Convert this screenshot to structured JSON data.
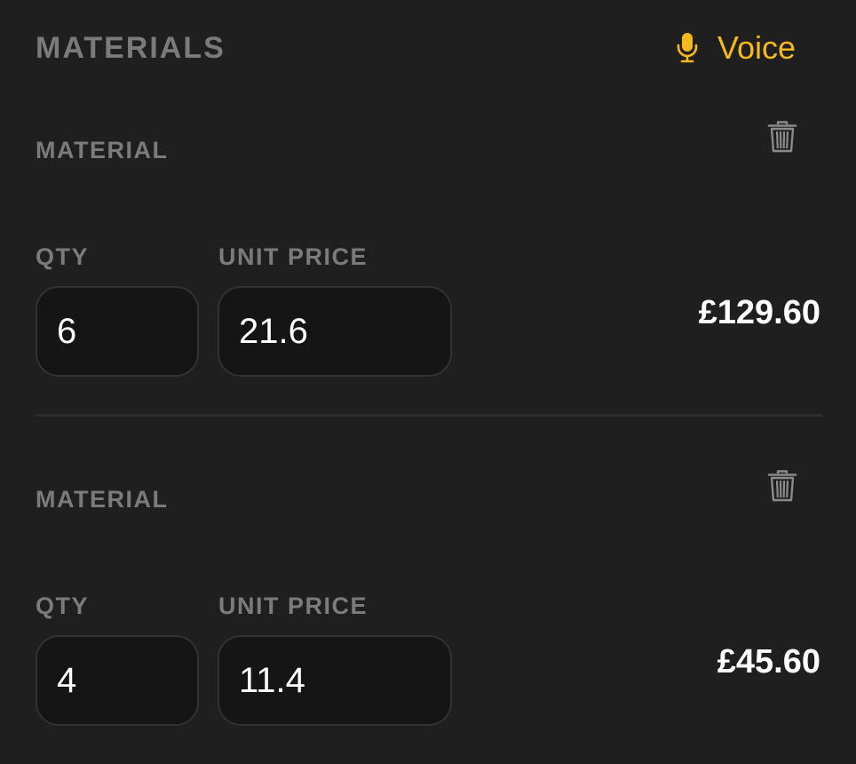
{
  "header": {
    "title": "MATERIALS",
    "voice_label": "Voice",
    "voice_icon": "microphone-icon"
  },
  "materials": [
    {
      "label": "MATERIAL",
      "delete_icon": "trash-icon",
      "qty_label": "QTY",
      "qty_value": "6",
      "unit_price_label": "UNIT PRICE",
      "unit_price_value": "21.6",
      "line_total": "£129.60"
    },
    {
      "label": "MATERIAL",
      "delete_icon": "trash-icon",
      "qty_label": "QTY",
      "qty_value": "4",
      "unit_price_label": "UNIT PRICE",
      "unit_price_value": "11.4",
      "line_total": "£45.60"
    }
  ],
  "colors": {
    "background": "#1f1f1f",
    "accent": "#f5b91c",
    "muted_text": "#7b7b7b",
    "input_background": "#151515"
  }
}
